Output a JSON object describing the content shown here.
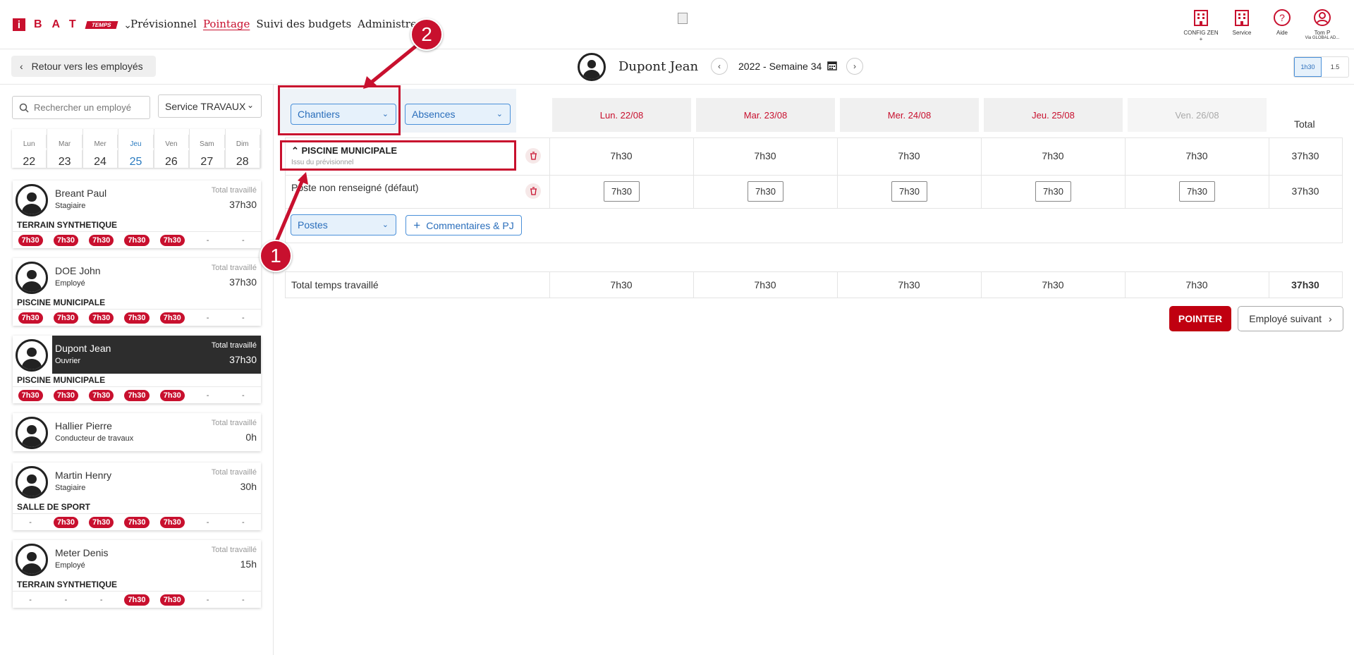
{
  "nav": {
    "logo_letters": "BAT",
    "logo_tag": "TEMPS",
    "items": [
      "Prévisionnel",
      "Pointage",
      "Suivi des budgets",
      "Administrer"
    ],
    "active": "Pointage"
  },
  "top_icons": [
    {
      "label": "CONFIG ZEN\n+",
      "icon": "building-icon"
    },
    {
      "label": "Service",
      "icon": "building-icon"
    },
    {
      "label": "Aide",
      "icon": "help-icon"
    },
    {
      "label": "Tom P",
      "sub": "Via GLOBAL AD...",
      "icon": "user-icon"
    }
  ],
  "back_label": "Retour vers les employés",
  "employee_name": "Dupont Jean",
  "week_label": "2022 - Semaine 34",
  "toggle": [
    "1h30",
    "1.5"
  ],
  "sidebar": {
    "search_placeholder": "Rechercher un employé",
    "service": "Service TRAVAUX",
    "days": [
      {
        "name": "Lun",
        "num": "22"
      },
      {
        "name": "Mar",
        "num": "23"
      },
      {
        "name": "Mer",
        "num": "24"
      },
      {
        "name": "Jeu",
        "num": "25"
      },
      {
        "name": "Ven",
        "num": "26"
      },
      {
        "name": "Sam",
        "num": "27"
      },
      {
        "name": "Dim",
        "num": "28"
      }
    ],
    "total_label": "Total travaillé",
    "employees": [
      {
        "name": "Breant Paul",
        "role": "Stagiaire",
        "total": "37h30",
        "project": "TERRAIN SYNTHETIQUE",
        "cells": [
          "7h30",
          "7h30",
          "7h30",
          "7h30",
          "7h30",
          "-",
          "-"
        ]
      },
      {
        "name": "DOE John",
        "role": "Employé",
        "total": "37h30",
        "project": "PISCINE MUNICIPALE",
        "cells": [
          "7h30",
          "7h30",
          "7h30",
          "7h30",
          "7h30",
          "-",
          "-"
        ]
      },
      {
        "name": "Dupont Jean",
        "role": "Ouvrier",
        "total": "37h30",
        "project": "PISCINE MUNICIPALE",
        "cells": [
          "7h30",
          "7h30",
          "7h30",
          "7h30",
          "7h30",
          "-",
          "-"
        ]
      },
      {
        "name": "Hallier Pierre",
        "role": "Conducteur de travaux",
        "total": "0h",
        "project": "",
        "cells": []
      },
      {
        "name": "Martin Henry",
        "role": "Stagiaire",
        "total": "30h",
        "project": "SALLE DE SPORT",
        "cells": [
          "-",
          "7h30",
          "7h30",
          "7h30",
          "7h30",
          "-",
          "-"
        ]
      },
      {
        "name": "Meter Denis",
        "role": "Employé",
        "total": "15h",
        "project": "TERRAIN SYNTHETIQUE",
        "cells": [
          "-",
          "-",
          "-",
          "7h30",
          "7h30",
          "-",
          "-"
        ]
      }
    ]
  },
  "main": {
    "chantiers": "Chantiers",
    "absences": "Absences",
    "day_headers": [
      "Lun. 22/08",
      "Mar. 23/08",
      "Mer. 24/08",
      "Jeu. 25/08",
      "Ven. 26/08"
    ],
    "total_header": "Total",
    "project_title": "PISCINE MUNICIPALE",
    "project_sub": "Issu du prévisionnel",
    "project_row": [
      "7h30",
      "7h30",
      "7h30",
      "7h30",
      "7h30",
      "37h30"
    ],
    "poste_label": "Poste non renseigné (défaut)",
    "poste_row": [
      "7h30",
      "7h30",
      "7h30",
      "7h30",
      "7h30",
      "37h30"
    ],
    "postes_btn": "Postes",
    "comments_btn": "Commentaires & PJ",
    "total_label": "Total temps travaillé",
    "total_row": [
      "7h30",
      "7h30",
      "7h30",
      "7h30",
      "7h30",
      "37h30"
    ],
    "pointer_btn": "POINTER",
    "next_btn": "Employé suivant"
  },
  "annotations": [
    "1",
    "2"
  ],
  "colors": {
    "brand": "#c8102e",
    "accent_blue": "#2a6ebb"
  }
}
